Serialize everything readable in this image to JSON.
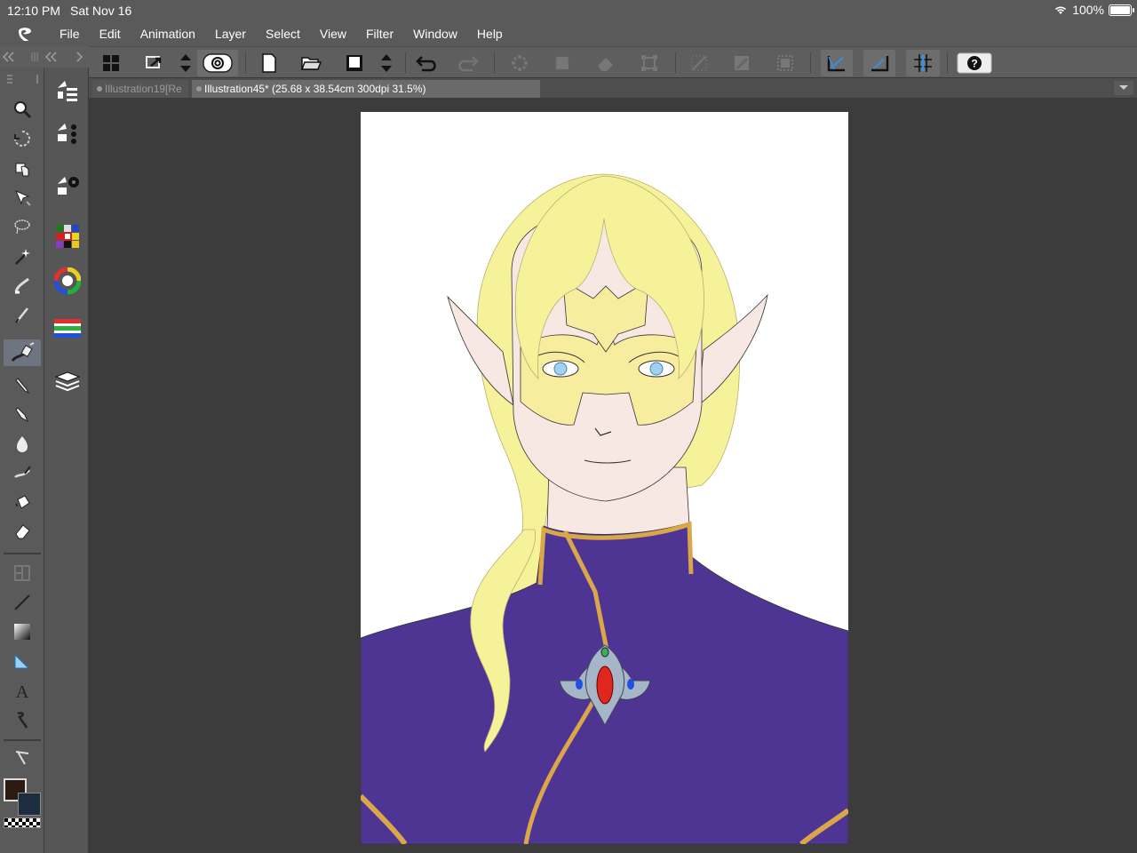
{
  "status": {
    "time": "12:10 PM",
    "date": "Sat Nov 16",
    "battery": "100%",
    "battery_level_percent": 100
  },
  "menu": [
    "File",
    "Edit",
    "Animation",
    "Layer",
    "Select",
    "View",
    "Filter",
    "Window",
    "Help"
  ],
  "tabs": [
    {
      "label": "Illustration19[Re",
      "active": false
    },
    {
      "label": "Illustration45* (25.68 x 38.54cm 300dpi 31.5%)",
      "active": true
    }
  ],
  "command_icons": [
    "grid-icon",
    "share-icon",
    "up-down-icon",
    "clip-studio-logo-icon",
    "new-file-icon",
    "open-folder-icon",
    "save-icon",
    "up-down-icon",
    "undo-icon",
    "redo-icon",
    "clear-selection-icon",
    "crop-icon",
    "clear-icon",
    "transform-icon",
    "snap-off-icon",
    "fill-icon",
    "select-all-icon",
    "snap-ruler-icon",
    "snap-special-ruler-icon",
    "snap-grid-icon",
    "help-icon"
  ],
  "tools": [
    "zoom-icon",
    "rotate-icon",
    "move-icon",
    "operation-icon",
    "lasso-icon",
    "magic-wand-icon",
    "eyedropper-brush-icon",
    "pen-icon",
    "ink-pen-icon",
    "pencil-icon",
    "brush-icon",
    "airbrush-icon",
    "blend-icon",
    "fill-bucket-icon",
    "eraser-icon",
    "frame-icon",
    "line-icon",
    "gradient-icon",
    "ruler-icon",
    "text-icon",
    "balloon-icon",
    "correct-line-icon"
  ],
  "palette_icons": [
    "tool-property-icon",
    "sub-tool-icon",
    "sub-tool-detail-icon",
    "color-set-icon",
    "color-wheel-icon",
    "color-slider-icon",
    "layer-icon"
  ],
  "colors": {
    "main_color": "#2a1a10",
    "sub_color": "#1e2c40",
    "hair": "#f6f29a",
    "skin": "#f7e8e4",
    "mask": "#f8ec9f",
    "robe": "#4e3594",
    "trim": "#d9a74a",
    "gem": "#e0271d",
    "iris": "#9fd2f2"
  }
}
